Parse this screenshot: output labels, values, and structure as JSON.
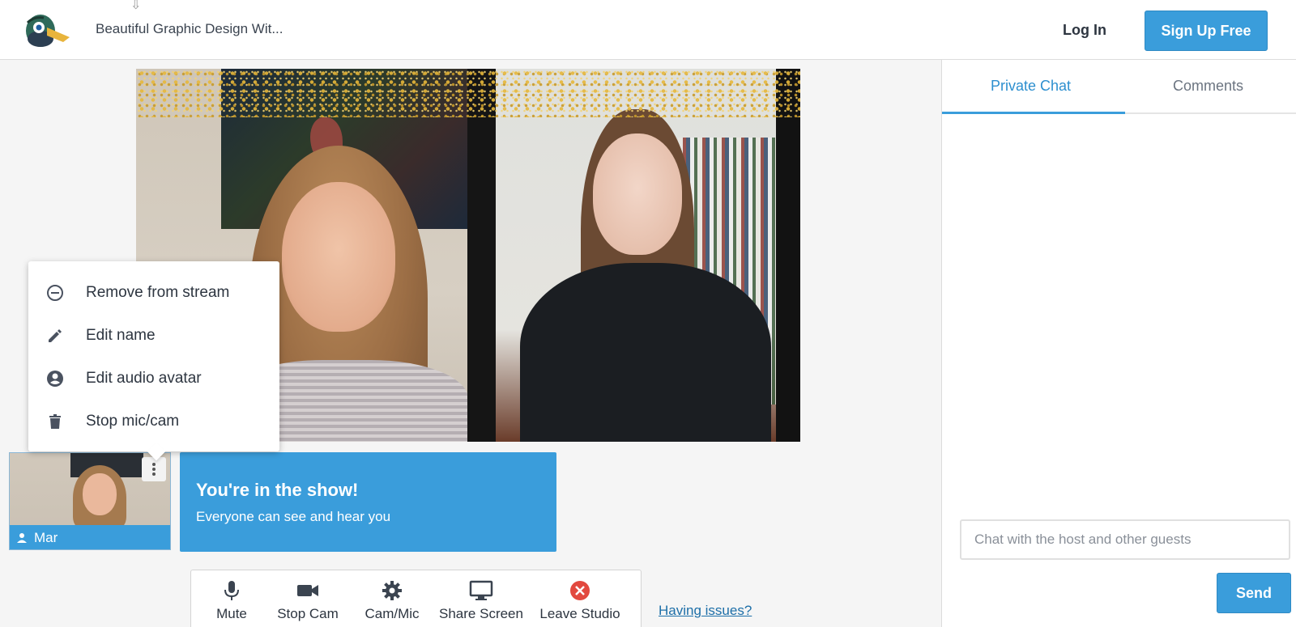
{
  "header": {
    "logo_icon": "duck-logo-icon",
    "show_title": "Beautiful Graphic Design Wit...",
    "login_label": "Log In",
    "signup_label": "Sign Up Free"
  },
  "context_menu": {
    "items": [
      {
        "icon": "minus-circle-icon",
        "label": "Remove from stream"
      },
      {
        "icon": "pencil-icon",
        "label": "Edit name"
      },
      {
        "icon": "account-circle-icon",
        "label": "Edit audio avatar"
      },
      {
        "icon": "trash-icon",
        "label": "Stop mic/cam"
      }
    ]
  },
  "self_tile": {
    "name": "Mar",
    "icon": "person-icon",
    "more_icon": "vertical-dots-icon"
  },
  "banner": {
    "title": "You're in the show!",
    "subtitle": "Everyone can see and hear you"
  },
  "controls": [
    {
      "icon": "microphone-icon",
      "label": "Mute"
    },
    {
      "icon": "video-camera-icon",
      "label": "Stop Cam"
    },
    {
      "icon": "gear-icon",
      "label": "Cam/Mic"
    },
    {
      "icon": "monitor-icon",
      "label": "Share Screen"
    },
    {
      "icon": "close-circle-icon",
      "label": "Leave Studio"
    }
  ],
  "help_link": "Having issues?",
  "sidebar": {
    "tabs": [
      {
        "label": "Private Chat",
        "active": true
      },
      {
        "label": "Comments",
        "active": false
      }
    ],
    "chat_placeholder": "Chat with the host and other guests",
    "send_label": "Send"
  },
  "colors": {
    "accent": "#3a9ddb",
    "leave_red": "#e2493f",
    "link": "#1d6fa8"
  }
}
